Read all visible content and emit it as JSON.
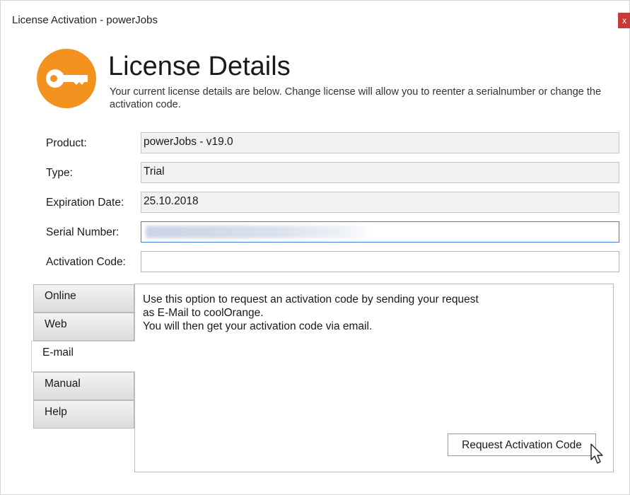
{
  "window": {
    "title": "License Activation - powerJobs",
    "close_glyph": "x"
  },
  "header": {
    "icon": "key-icon",
    "title": "License Details",
    "description": "Your current license details are below. Change license will allow you to reenter a serialnumber or change the activation code."
  },
  "fields": {
    "product": {
      "label": "Product:",
      "value": "powerJobs - v19.0"
    },
    "type": {
      "label": "Type:",
      "value": "Trial"
    },
    "expiration": {
      "label": "Expiration Date:",
      "value": "25.10.2018"
    },
    "serial": {
      "label": "Serial Number:",
      "value": ""
    },
    "activation": {
      "label": "Activation Code:",
      "value": ""
    }
  },
  "tabs": [
    {
      "label": "Online",
      "active": false
    },
    {
      "label": "Web",
      "active": false
    },
    {
      "label": "E-mail",
      "active": true
    },
    {
      "label": "Manual",
      "active": false
    },
    {
      "label": "Help",
      "active": false
    }
  ],
  "panel": {
    "lines": [
      "Use this option to request an activation code by sending your request",
      "as E-Mail to coolOrange.",
      "You will then get your activation code via email."
    ],
    "button_label": "Request Activation Code"
  },
  "colors": {
    "accent": "#f4921f",
    "focus": "#3c7fd1",
    "close": "#c73a3a"
  }
}
